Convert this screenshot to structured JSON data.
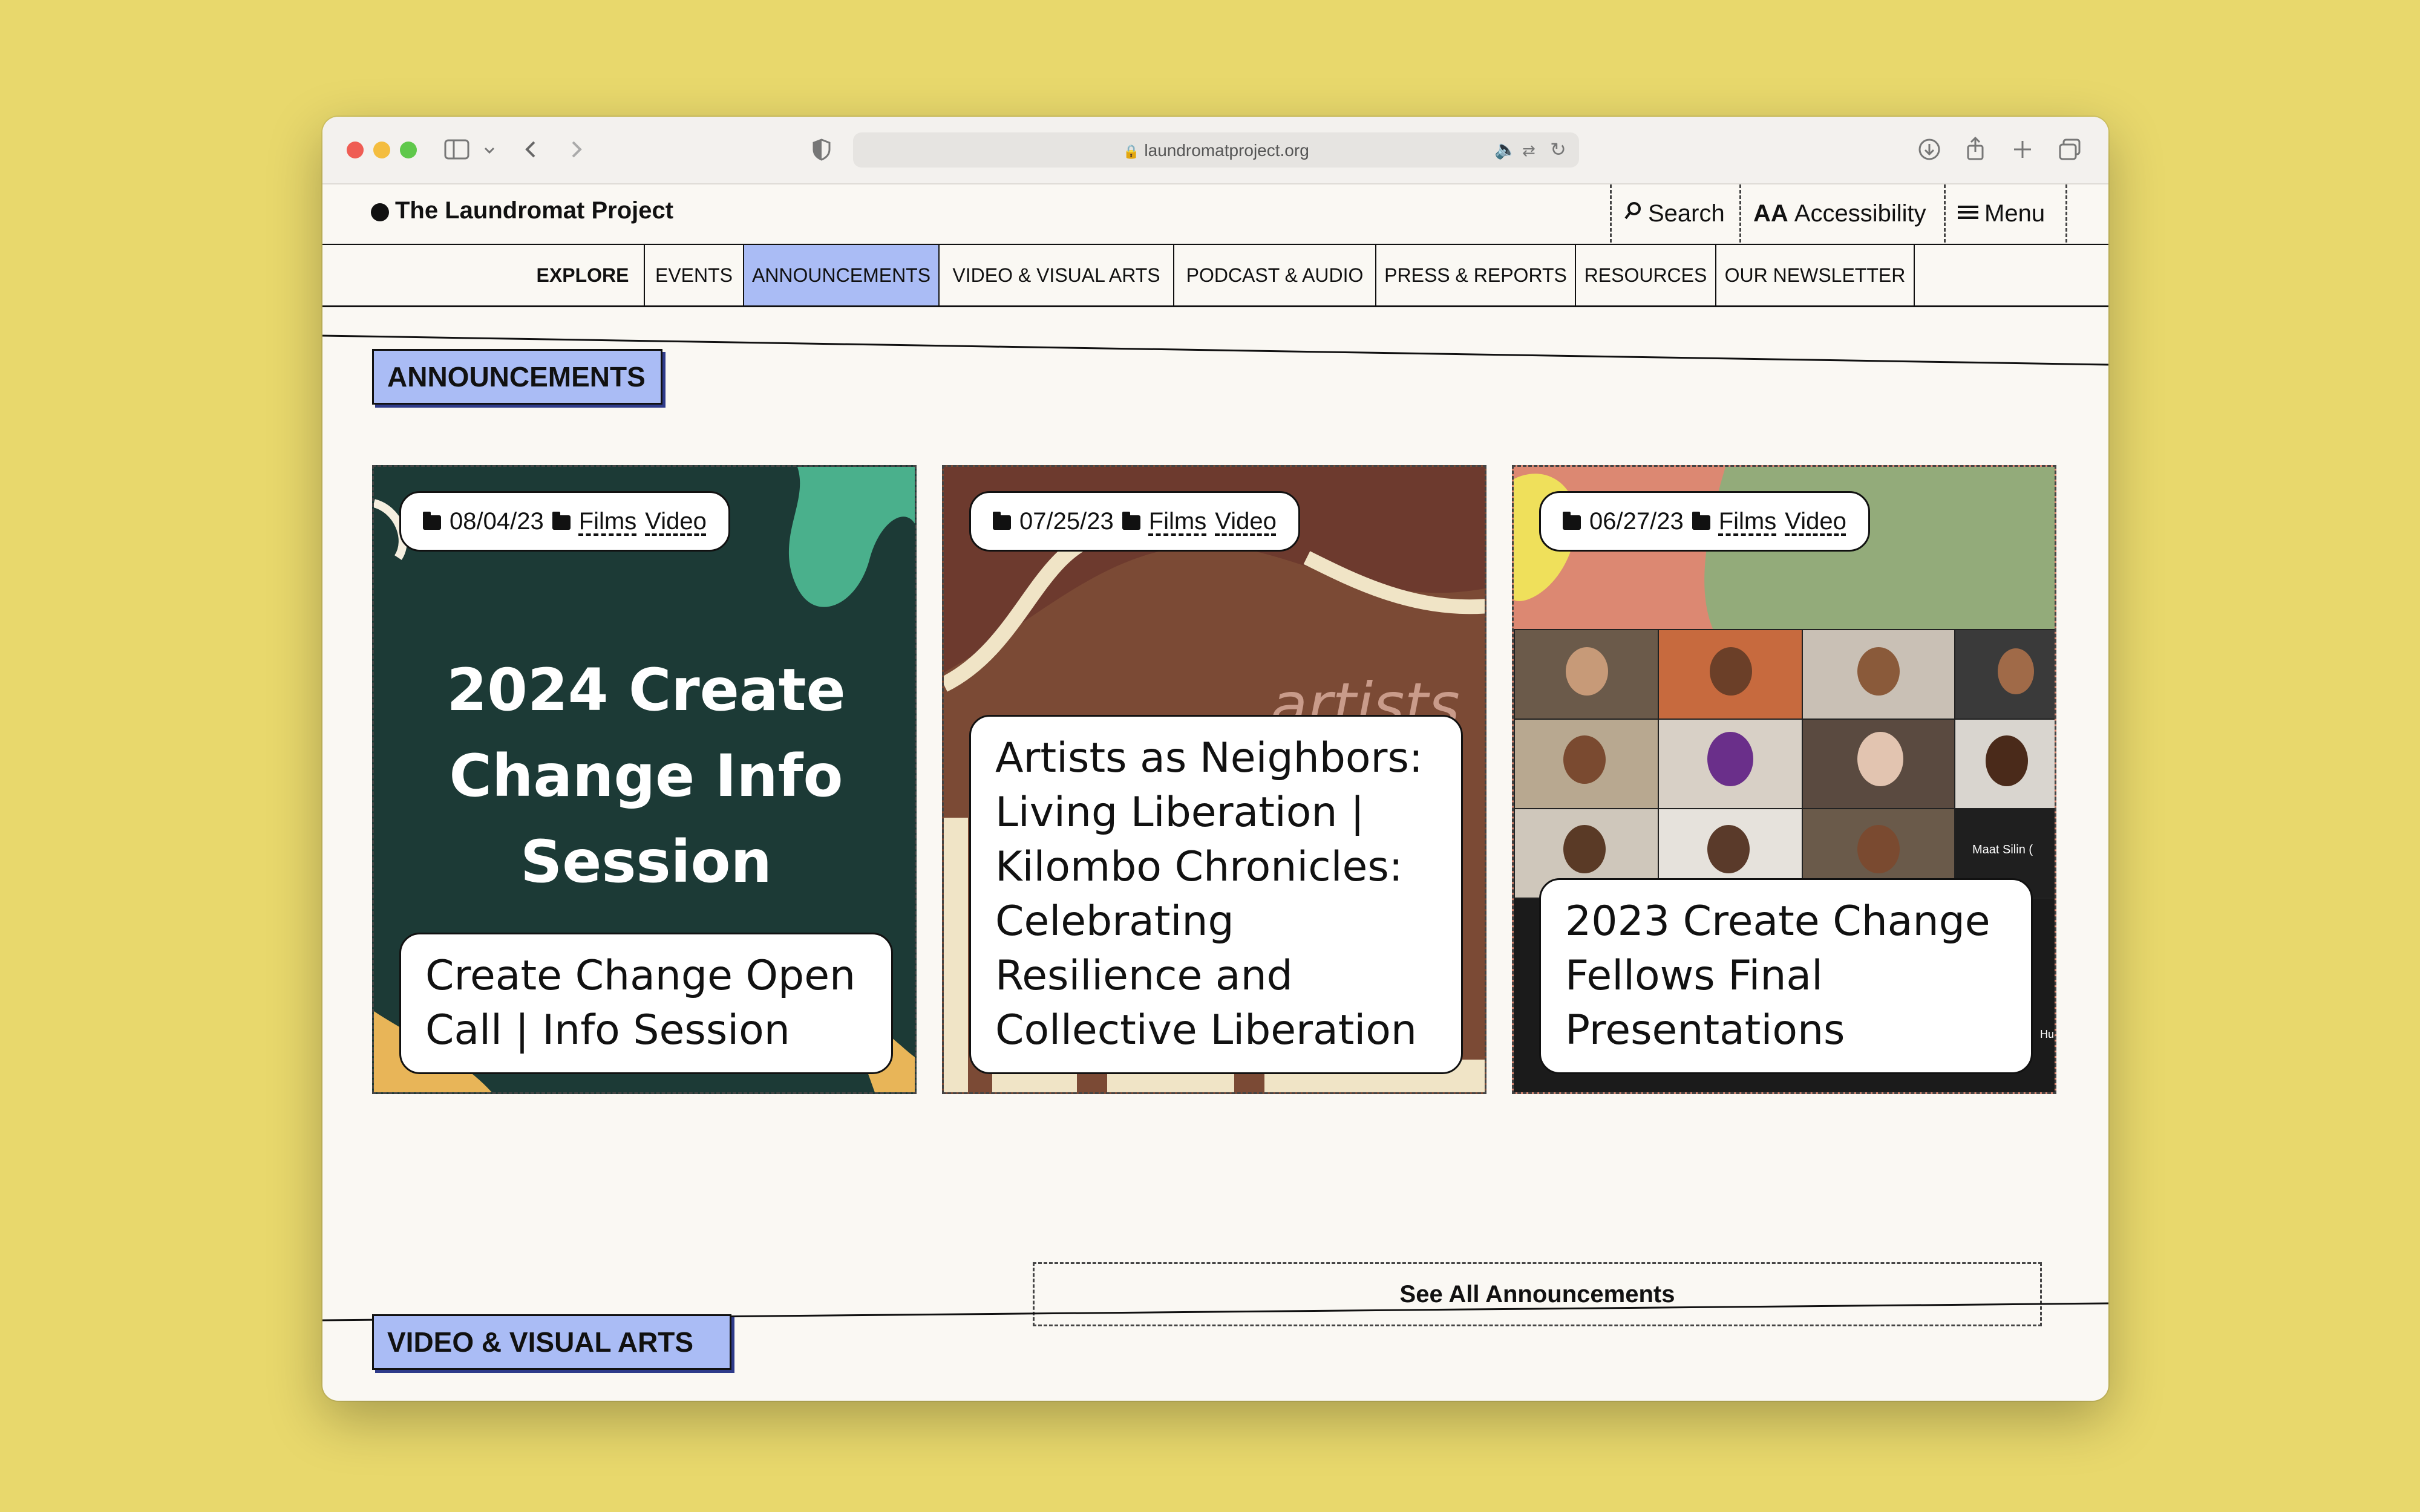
{
  "browser": {
    "url": "laundromatproject.org"
  },
  "site": {
    "logo": "The Laundromat Project",
    "header_buttons": {
      "search": "Search",
      "accessibility_glyph": "AA",
      "accessibility": "Accessibility",
      "menu": "Menu"
    }
  },
  "subnav": {
    "explore": "EXPLORE",
    "items": [
      "EVENTS",
      "ANNOUNCEMENTS",
      "VIDEO & VISUAL ARTS",
      "PODCAST & AUDIO",
      "PRESS & REPORTS",
      "RESOURCES",
      "OUR NEWSLETTER"
    ],
    "active": "ANNOUNCEMENTS"
  },
  "announcements": {
    "heading": "ANNOUNCEMENTS",
    "cards": [
      {
        "date": "08/04/23",
        "tags": [
          "Films",
          "Video"
        ],
        "image_text": [
          "2024 Create",
          "Change Info",
          "Session"
        ],
        "title": "Create Change Open Call | Info Session"
      },
      {
        "date": "07/25/23",
        "tags": [
          "Films",
          "Video"
        ],
        "image_text": [
          "artists"
        ],
        "title": "Artists as Neighbors: Living Liberation | Kilombo Chronicles: Celebrating Resilience and Collective Liberation"
      },
      {
        "date": "06/27/23",
        "tags": [
          "Films",
          "Video"
        ],
        "image_text": [
          "Maat Silin (",
          "Hua"
        ],
        "title": "2023 Create Change Fellows Final Presentations"
      }
    ],
    "see_all": "See All Announcements"
  },
  "video_section": {
    "heading": "VIDEO & VISUAL ARTS"
  },
  "colors": {
    "background": "#e8d86c",
    "accent": "#aabcf5",
    "card1_bg": "#1c3a36",
    "card2_bg": "#7b4a35",
    "card3_bg": "#dc8872"
  }
}
